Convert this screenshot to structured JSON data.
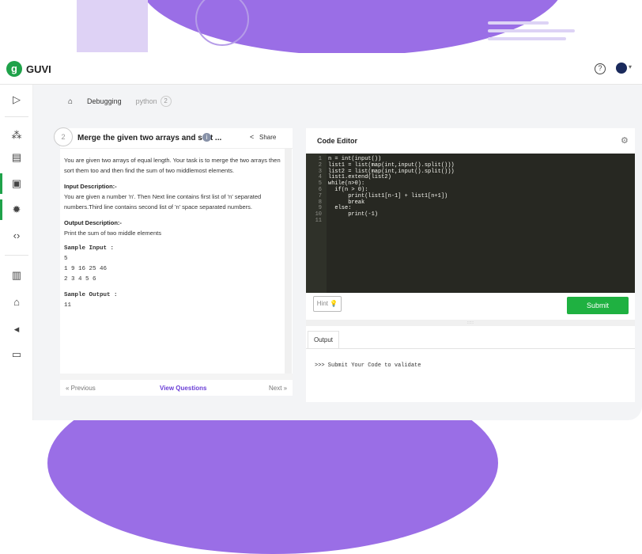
{
  "app": {
    "logo_mark": "g",
    "logo_text": "GUVI",
    "help_icon": "?",
    "caret": "▾"
  },
  "sidebar": [
    {
      "name": "play-icon",
      "glyph": "▷"
    },
    {
      "name": "shapes-icon",
      "glyph": "⁂"
    },
    {
      "name": "calendar-icon",
      "glyph": "▤"
    },
    {
      "name": "code-terminal-icon",
      "glyph": "▣"
    },
    {
      "name": "bug-icon",
      "glyph": "✹"
    },
    {
      "name": "code-brackets-icon",
      "glyph": "‹›"
    },
    {
      "name": "leaderboard-icon",
      "glyph": "▥"
    },
    {
      "name": "gift-icon",
      "glyph": "⌂"
    },
    {
      "name": "megaphone-icon",
      "glyph": "◂"
    },
    {
      "name": "chat-icon",
      "glyph": "▭"
    }
  ],
  "breadcrumb": {
    "home": "⌂",
    "item": "Debugging",
    "python": "python",
    "badge": "2"
  },
  "question": {
    "number": "2",
    "title": "Merge the given two arrays and sort ...",
    "info_icon": "i",
    "share_icon": "<",
    "share_label": "Share",
    "description": "You are given two arrays of equal length. Your task is to merge the two arrays then sort them too and then find the sum of two middlemost elements.",
    "input_label": "Input Description:-",
    "input_text": "You are given a number 'n'. Then Next line contains first list of 'n' separated numbers.Third line contains second list of 'n' space separated numbers.",
    "output_label": "Output Description:-",
    "output_text": "Print the sum of two middle elements",
    "sample_input_label": "Sample Input :",
    "sample_input_lines": [
      "5",
      "1 9 16 25 46",
      "2 3 4 5 6"
    ],
    "sample_output_label": "Sample Output :",
    "sample_output_lines": [
      "11"
    ],
    "prev": "« Previous",
    "view": "View Questions",
    "next": "Next »"
  },
  "editor": {
    "title": "Code Editor",
    "gear_icon": "⚙",
    "lines": [
      {
        "n": "1",
        "t": "n = int(input())"
      },
      {
        "n": "2",
        "t": "list1 = list(map(int,input().split()))"
      },
      {
        "n": "3",
        "t": "list2 = list(map(int,input().split()))"
      },
      {
        "n": "4",
        "t": "list1.extend(list2)"
      },
      {
        "n": "5",
        "t": "while(n>0):"
      },
      {
        "n": "6",
        "t": "  if(n > 0):"
      },
      {
        "n": "7",
        "t": "      print(list1[n-1] + list1[n+1])"
      },
      {
        "n": "8",
        "t": "      break"
      },
      {
        "n": "9",
        "t": "  else:"
      },
      {
        "n": "10",
        "t": "      print(-1)"
      },
      {
        "n": "11",
        "t": ""
      }
    ],
    "hint": "Hint 💡",
    "submit": "Submit",
    "resizer": "::::::",
    "output_tab": "Output",
    "output_text": ">>> Submit Your Code to validate"
  }
}
